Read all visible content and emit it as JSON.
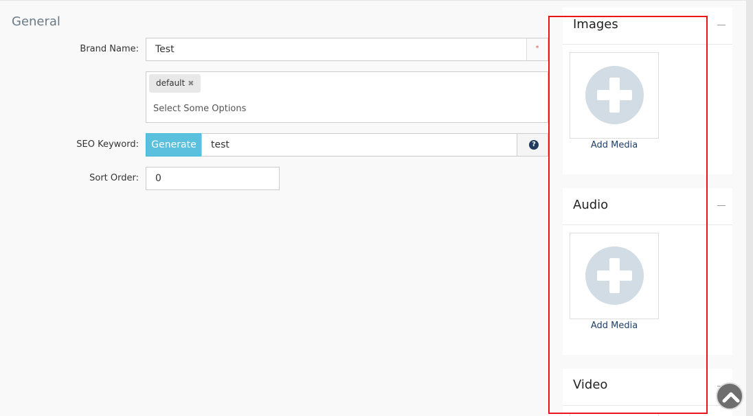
{
  "section": {
    "title": "General"
  },
  "form": {
    "brand_name": {
      "label": "Brand Name:",
      "value": "Test",
      "required_mark": "*"
    },
    "stores": {
      "tags": [
        {
          "label": "default",
          "remove_icon": "✖"
        }
      ],
      "placeholder": "Select Some Options"
    },
    "seo_keyword": {
      "label": "SEO Keyword:",
      "button_label": "Generate",
      "value": "test",
      "help_icon": "?"
    },
    "sort_order": {
      "label": "Sort Order:",
      "value": "0"
    }
  },
  "panels": {
    "images": {
      "title": "Images",
      "add_label": "Add Media"
    },
    "audio": {
      "title": "Audio",
      "add_label": "Add Media"
    },
    "video": {
      "title": "Video"
    }
  },
  "colors": {
    "accent": "#5bc0de",
    "highlight": "#e8141a",
    "placeholder_icon": "#d1dce4"
  }
}
